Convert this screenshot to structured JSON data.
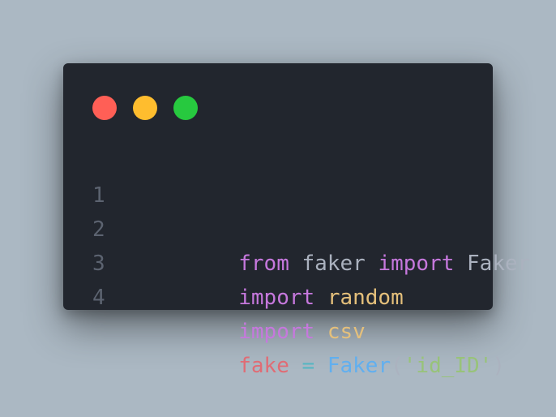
{
  "window": {
    "buttons": [
      {
        "name": "close",
        "color": "#ff5f56"
      },
      {
        "name": "minimize",
        "color": "#ffbd2e"
      },
      {
        "name": "maximize",
        "color": "#27c93f"
      }
    ]
  },
  "colors": {
    "background": "#abb8c3",
    "editor": "#22262e",
    "line_number": "#5c6370",
    "keyword": "#c678dd",
    "plain": "#abb2bf",
    "module": "#e5c07b",
    "variable": "#e06c75",
    "operator": "#56b6c2",
    "function": "#61afef",
    "string": "#98c379"
  },
  "code": {
    "lines": [
      {
        "number": "1",
        "tokens": [
          {
            "text": "from",
            "type": "keyword"
          },
          {
            "text": " faker ",
            "type": "plain"
          },
          {
            "text": "import",
            "type": "keyword"
          },
          {
            "text": " Faker",
            "type": "plain"
          }
        ]
      },
      {
        "number": "2",
        "tokens": [
          {
            "text": "import",
            "type": "keyword"
          },
          {
            "text": " ",
            "type": "plain"
          },
          {
            "text": "random",
            "type": "module"
          }
        ]
      },
      {
        "number": "3",
        "tokens": [
          {
            "text": "import",
            "type": "keyword"
          },
          {
            "text": " ",
            "type": "plain"
          },
          {
            "text": "csv",
            "type": "module"
          }
        ]
      },
      {
        "number": "4",
        "tokens": [
          {
            "text": "fake",
            "type": "variable"
          },
          {
            "text": " ",
            "type": "plain"
          },
          {
            "text": "=",
            "type": "operator"
          },
          {
            "text": " ",
            "type": "plain"
          },
          {
            "text": "Faker",
            "type": "function"
          },
          {
            "text": "(",
            "type": "plain"
          },
          {
            "text": "'id_ID'",
            "type": "string"
          },
          {
            "text": ")",
            "type": "plain"
          }
        ]
      }
    ]
  }
}
